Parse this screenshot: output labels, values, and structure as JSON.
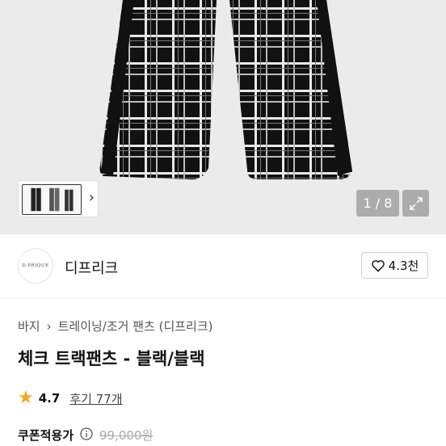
{
  "gallery": {
    "counter": "1 / 8",
    "expand_icon": "expand-icon",
    "next_icon": "chevron-right-icon"
  },
  "shop": {
    "logo_text": "D.PRIQUE",
    "name": "디프리크",
    "follow_count": "4.3천",
    "follow_icon": "heart-icon"
  },
  "breadcrumb": {
    "items": [
      "바지",
      "트레이닝/조거 팬츠 (디프리크)"
    ]
  },
  "product": {
    "title": "체크 트랙팬츠 - 블랙/블랙",
    "rating": "4.7",
    "reviews": "후기 77개",
    "coupon_label": "쿠폰적용가",
    "original_price": "99,000원"
  },
  "colors": {
    "star": "#f5a623",
    "background": "#ebebeb"
  }
}
